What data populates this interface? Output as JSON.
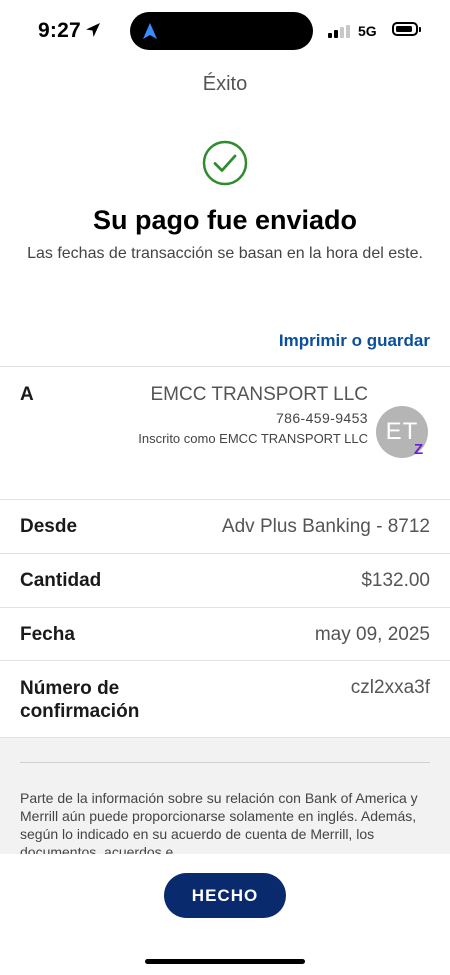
{
  "status_bar": {
    "time": "9:27",
    "network": "5G",
    "icons": [
      "location-arrow-icon",
      "cellular-signal-icon",
      "battery-icon"
    ]
  },
  "header": {
    "title": "Éxito"
  },
  "success": {
    "icon": "check-circle-icon",
    "headline": "Su pago fue enviado",
    "subtitle": "Las fechas de transacción se basan en la hora del este."
  },
  "print_link": "Imprimir o guardar",
  "details": {
    "to_label": "A",
    "payee_name": "EMCC TRANSPORT LLC",
    "payee_phone": "786-459-9453",
    "payee_registered": "Inscrito como EMCC TRANSPORT LLC",
    "avatar_initials": "ET",
    "zelle_symbol": "Z",
    "from_label": "Desde",
    "from_value": "Adv Plus Banking - 8712",
    "amount_label": "Cantidad",
    "amount_value": "$132.00",
    "date_label": "Fecha",
    "date_value": "may 09, 2025",
    "confirmation_label": "Número de confirmación",
    "confirmation_value": "czl2xxa3f"
  },
  "disclaimer": "Parte de la información sobre su relación con Bank of America y Merrill aún puede proporcionarse solamente en inglés. Además, según lo indicado en su acuerdo de cuenta de Merrill, los documentos, acuerdos e",
  "done_button": "HECHO",
  "colors": {
    "accent": "#0b4f9c",
    "success": "#2e8b2e",
    "button": "#0a2a6e",
    "zelle": "#6d1ed4"
  }
}
